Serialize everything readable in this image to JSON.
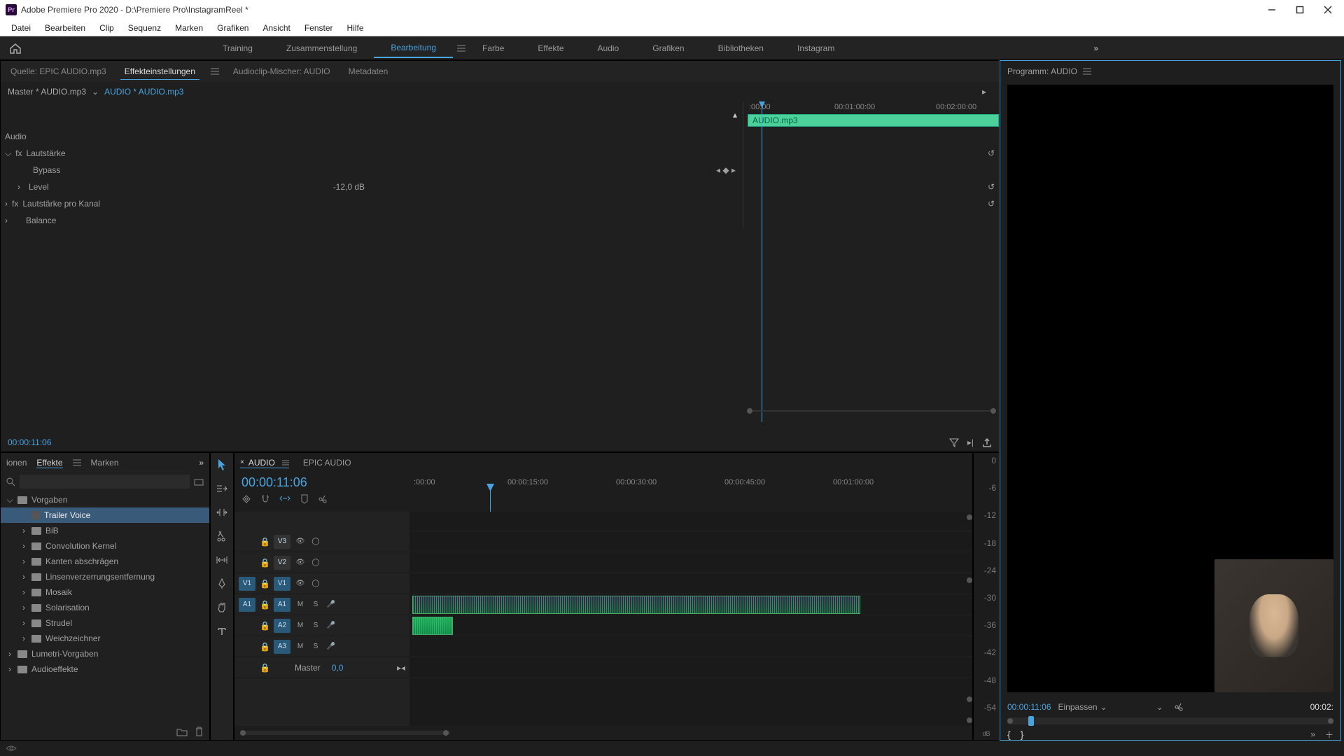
{
  "titlebar": {
    "app_icon_text": "Pr",
    "title": "Adobe Premiere Pro 2020 - D:\\Premiere Pro\\InstagramReel *"
  },
  "menubar": [
    "Datei",
    "Bearbeiten",
    "Clip",
    "Sequenz",
    "Marken",
    "Grafiken",
    "Ansicht",
    "Fenster",
    "Hilfe"
  ],
  "workspaces": {
    "items": [
      "Training",
      "Zusammenstellung",
      "Bearbeitung",
      "Farbe",
      "Effekte",
      "Audio",
      "Grafiken",
      "Bibliotheken",
      "Instagram"
    ],
    "active_index": 2
  },
  "source_tabs": {
    "items": [
      "Quelle: EPIC AUDIO.mp3",
      "Effekteinstellungen",
      "Audioclip-Mischer: AUDIO",
      "Metadaten"
    ],
    "active_index": 1
  },
  "effect_controls": {
    "master_label": "Master * AUDIO.mp3",
    "clip_label": "AUDIO * AUDIO.mp3",
    "ruler_ticks": [
      ":00:00",
      "00:01:00:00",
      "00:02:00:00"
    ],
    "clip_name": "AUDIO.mp3",
    "section_label": "Audio",
    "props": {
      "volume": {
        "name": "Lautstärke",
        "bypass": "Bypass",
        "level_name": "Level",
        "level_value": "-12,0 dB"
      },
      "channel_volume": {
        "name": "Lautstärke pro Kanal"
      },
      "balance": {
        "name": "Balance"
      }
    },
    "timecode": "00:00:11:06"
  },
  "program": {
    "title": "Programm: AUDIO",
    "timecode": "00:00:11:06",
    "zoom": "Einpassen",
    "duration": "00:02:"
  },
  "project": {
    "tabs": [
      "ionen",
      "Effekte",
      "Marken"
    ],
    "active_index": 1,
    "search_placeholder": "",
    "tree": [
      {
        "type": "folder",
        "name": "Vorgaben",
        "indent": 0,
        "expanded": true
      },
      {
        "type": "preset",
        "name": "Trailer Voice",
        "indent": 1,
        "selected": true
      },
      {
        "type": "folder",
        "name": "BiB",
        "indent": 1
      },
      {
        "type": "folder",
        "name": "Convolution Kernel",
        "indent": 1
      },
      {
        "type": "folder",
        "name": "Kanten abschrägen",
        "indent": 1
      },
      {
        "type": "folder",
        "name": "Linsenverzerrungsentfernung",
        "indent": 1
      },
      {
        "type": "folder",
        "name": "Mosaik",
        "indent": 1
      },
      {
        "type": "folder",
        "name": "Solarisation",
        "indent": 1
      },
      {
        "type": "folder",
        "name": "Strudel",
        "indent": 1
      },
      {
        "type": "folder",
        "name": "Weichzeichner",
        "indent": 1
      },
      {
        "type": "folder",
        "name": "Lumetri-Vorgaben",
        "indent": 0
      },
      {
        "type": "folder",
        "name": "Audioeffekte",
        "indent": 0
      }
    ]
  },
  "timeline": {
    "tabs": [
      {
        "name": "AUDIO",
        "active": true
      },
      {
        "name": "EPIC AUDIO",
        "active": false
      }
    ],
    "timecode": "00:00:11:06",
    "ruler_ticks": [
      ":00:00",
      "00:00:15:00",
      "00:00:30:00",
      "00:00:45:00",
      "00:01:00:00"
    ],
    "video_tracks": [
      "V3",
      "V2",
      "V1"
    ],
    "audio_tracks": [
      "A1",
      "A2",
      "A3"
    ],
    "source_patch": {
      "V1": "V1",
      "A1": "A1"
    },
    "master": {
      "label": "Master",
      "value": "0,0"
    }
  },
  "meters": {
    "ticks": [
      "0",
      "-6",
      "-12",
      "-18",
      "-24",
      "-30",
      "-36",
      "-42",
      "-48",
      "-54",
      ""
    ],
    "unit": "dB"
  }
}
